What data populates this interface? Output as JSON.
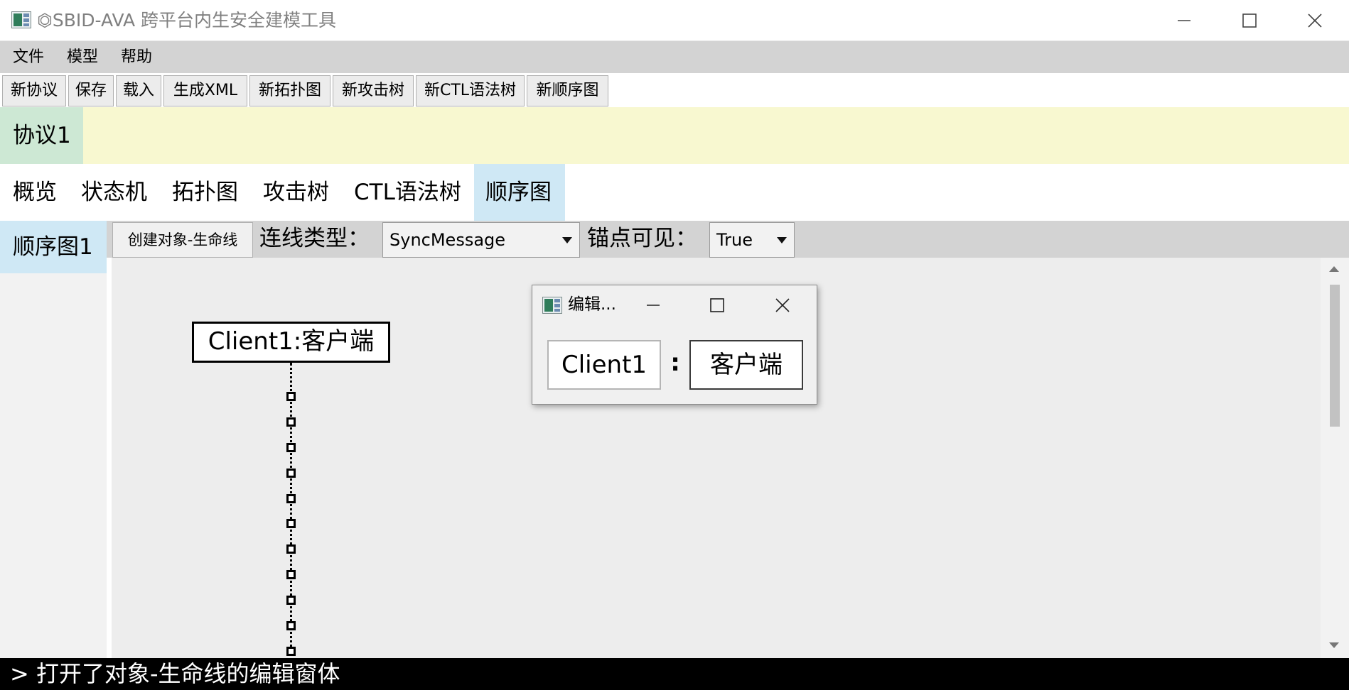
{
  "window": {
    "title": "⏣SBID-AVA 跨平台内生安全建模工具"
  },
  "menu": {
    "file": "文件",
    "model": "模型",
    "help": "帮助"
  },
  "toolbar": {
    "buttons": [
      "新协议",
      "保存",
      "载入",
      "生成XML",
      "新拓扑图",
      "新攻击树",
      "新CTL语法树",
      "新顺序图"
    ]
  },
  "protocol_tab": "协议1",
  "view_tabs": {
    "items": [
      "概览",
      "状态机",
      "拓扑图",
      "攻击树",
      "CTL语法树",
      "顺序图"
    ],
    "active": "顺序图"
  },
  "sequence": {
    "tab": "顺序图1",
    "create_button": "创建对象-生命线",
    "link_type_label": "连线类型：",
    "link_type_value": "SyncMessage",
    "anchor_visible_label": "锚点可见：",
    "anchor_visible_value": "True",
    "lifeline_label": "Client1:客户端"
  },
  "dialog": {
    "title": "编辑...",
    "name_value": "Client1",
    "separator": ":",
    "type_value": "客户端"
  },
  "status": "> 打开了对象-生命线的编辑窗体",
  "colors": {
    "menubar": "#d3d3d3",
    "protocol_strip": "#f8f8d0",
    "protocol_tab": "#cde8d4",
    "active_tab": "#cfe8f5",
    "canvas": "#ededed",
    "statusbar": "#000000"
  }
}
